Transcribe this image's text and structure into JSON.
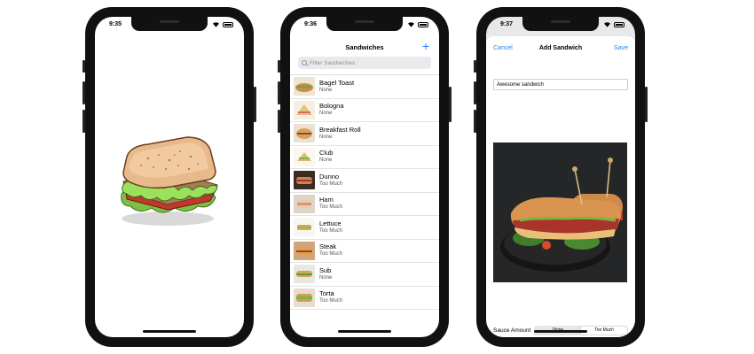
{
  "screens": [
    {
      "status_time": "9:35"
    },
    {
      "status_time": "9:36",
      "nav_title": "Sandwiches",
      "add_button": "+",
      "search_placeholder": "Filter Sandwiches",
      "items": [
        {
          "name": "Bagel Toast",
          "sauce": "None"
        },
        {
          "name": "Bologna",
          "sauce": "None"
        },
        {
          "name": "Breakfast Roll",
          "sauce": "None"
        },
        {
          "name": "Club",
          "sauce": "None"
        },
        {
          "name": "Dunno",
          "sauce": "Too Much"
        },
        {
          "name": "Ham",
          "sauce": "Too Much"
        },
        {
          "name": "Lettuce",
          "sauce": "Too Much"
        },
        {
          "name": "Steak",
          "sauce": "Too Much"
        },
        {
          "name": "Sub",
          "sauce": "None"
        },
        {
          "name": "Torta",
          "sauce": "Too Much"
        }
      ]
    },
    {
      "status_time": "9:37",
      "cancel_label": "Cancel",
      "title": "Add Sandwich",
      "save_label": "Save",
      "name_value": "Awesome sandwich",
      "sauce_label": "Sauce Amount",
      "sauce_options": [
        "None",
        "Too Much"
      ],
      "sauce_selected": "Too Much"
    }
  ],
  "colors": {
    "accent": "#1a84ff"
  }
}
